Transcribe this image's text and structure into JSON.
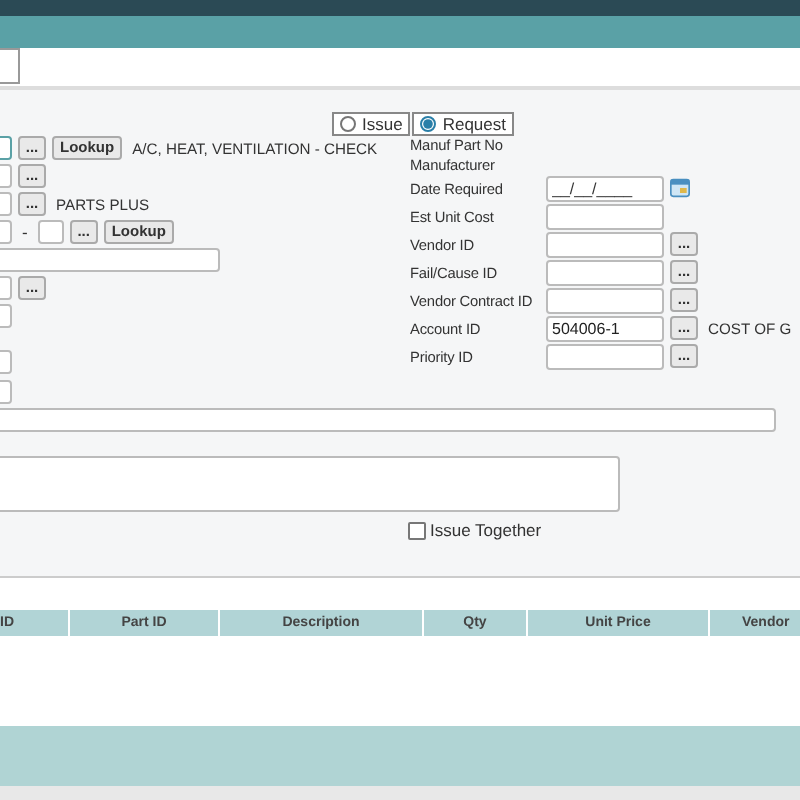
{
  "mode_radio": [
    {
      "label": "Issue",
      "selected": false
    },
    {
      "label": "Request",
      "selected": true
    }
  ],
  "left_rows": [
    {
      "kind": "lookup",
      "browse": "...",
      "lookup": "Lookup",
      "note": "A/C, HEAT, VENTILATION - CHECK"
    },
    {
      "kind": "browse",
      "browse": "..."
    },
    {
      "kind": "browse",
      "browse": "...",
      "note": "PARTS PLUS"
    },
    {
      "kind": "split",
      "separator": "-",
      "browse": "...",
      "lookup": "Lookup"
    },
    {
      "kind": "wide"
    },
    {
      "kind": "browse",
      "browse": "..."
    },
    {
      "kind": "plain"
    },
    {
      "kind": "plain"
    },
    {
      "kind": "plain"
    }
  ],
  "right_fields": [
    {
      "kind": "label",
      "label": "Manuf Part No"
    },
    {
      "kind": "label",
      "label": "Manufacturer"
    },
    {
      "kind": "date",
      "label": "Date Required",
      "placeholder": "__/__/____"
    },
    {
      "kind": "text",
      "label": "Est Unit Cost"
    },
    {
      "kind": "browse",
      "label": "Vendor ID",
      "browse": "..."
    },
    {
      "kind": "browse",
      "label": "Fail/Cause ID",
      "browse": "..."
    },
    {
      "kind": "browse",
      "label": "Vendor Contract ID",
      "browse": "..."
    },
    {
      "kind": "browse",
      "label": "Account ID",
      "value": "504006-1",
      "browse": "...",
      "note": "COST OF G"
    },
    {
      "kind": "browse",
      "label": "Priority ID",
      "browse": "..."
    }
  ],
  "issue_together": {
    "label": "Issue Together",
    "checked": false
  },
  "table": {
    "columns": [
      "ID",
      "Part ID",
      "Description",
      "Qty",
      "Unit Price",
      "Vendor"
    ]
  }
}
